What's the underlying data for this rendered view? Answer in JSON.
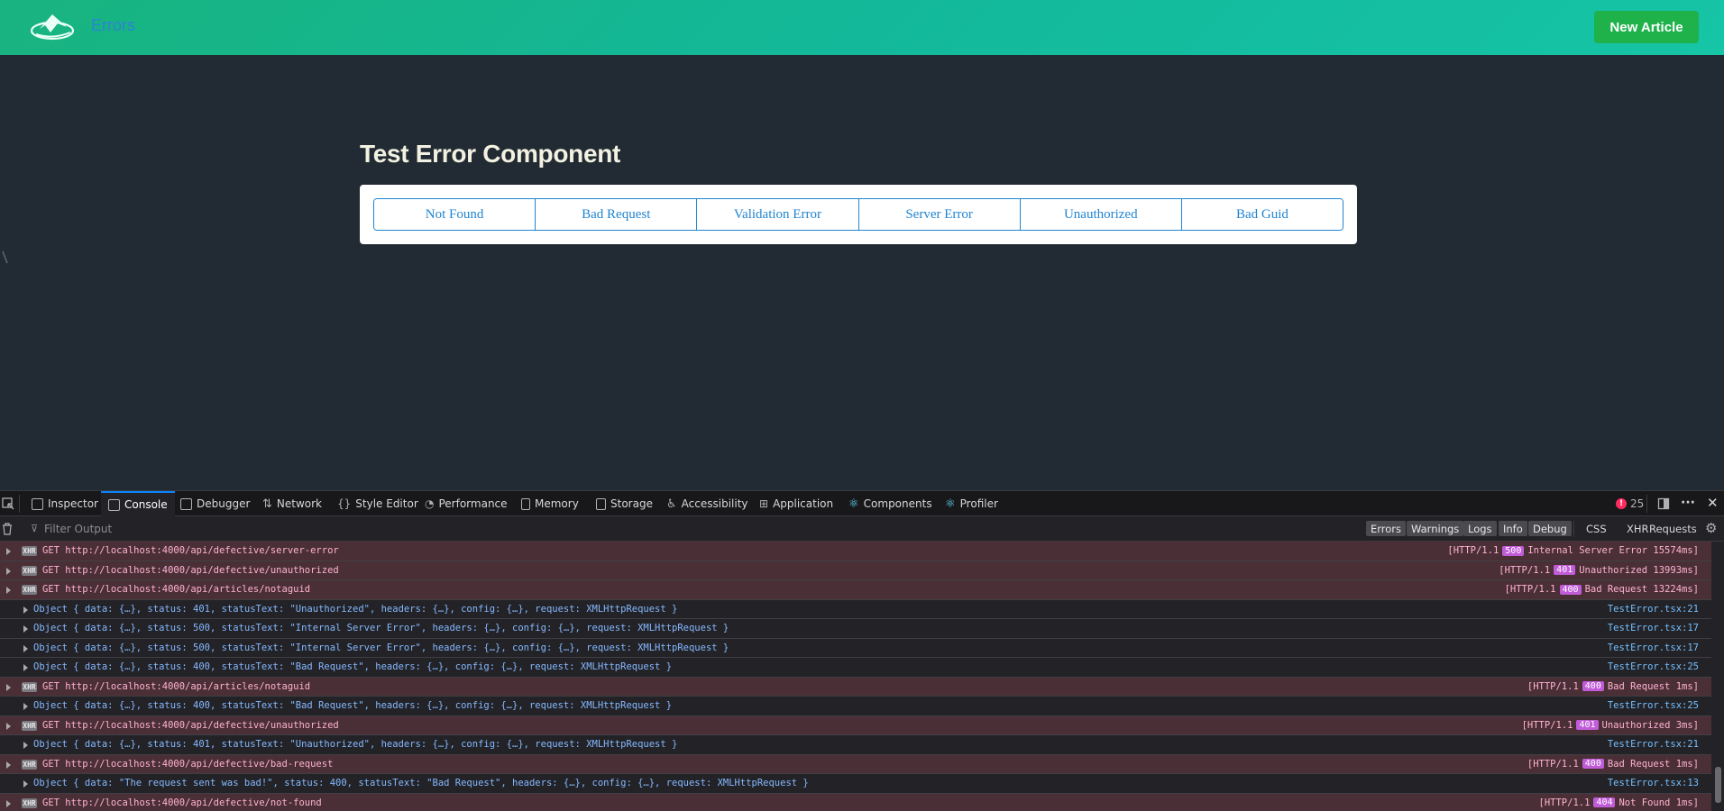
{
  "topnav": {
    "title": "Errors",
    "new_article_label": "New Article",
    "logo_icon": "reactivities-logo",
    "gradient_color": "#16b98f"
  },
  "main": {
    "heading": "Test Error Component",
    "buttons": [
      "Not Found",
      "Bad Request",
      "Validation Error",
      "Server Error",
      "Unauthorized",
      "Bad Guid"
    ],
    "accent": "#2185d0"
  },
  "devtools": {
    "tabs": [
      {
        "label": "Inspector",
        "icon": "inspector-icon"
      },
      {
        "label": "Console",
        "icon": "console-icon"
      },
      {
        "label": "Debugger",
        "icon": "debugger-icon"
      },
      {
        "label": "Network",
        "icon": "network-icon"
      },
      {
        "label": "Style Editor",
        "icon": "style-editor-icon"
      },
      {
        "label": "Performance",
        "icon": "performance-icon"
      },
      {
        "label": "Memory",
        "icon": "memory-icon"
      },
      {
        "label": "Storage",
        "icon": "storage-icon"
      },
      {
        "label": "Accessibility",
        "icon": "accessibility-icon"
      },
      {
        "label": "Application",
        "icon": "application-icon"
      },
      {
        "label": "Components",
        "icon": "react-icon"
      },
      {
        "label": "Profiler",
        "icon": "react-icon"
      }
    ],
    "active_tab": "Console",
    "error_count": "25",
    "filter_placeholder": "Filter Output",
    "filter_levels": [
      "Errors",
      "Warnings",
      "Logs",
      "Info",
      "Debug"
    ],
    "filter_types": [
      "CSS",
      "XHR",
      "Requests"
    ],
    "rows": [
      {
        "type": "xhr",
        "text": "GET http://localhost:4000/api/defective/server-error",
        "http": "[HTTP/1.1",
        "code": "500",
        "tail": "Internal Server Error 15574ms]"
      },
      {
        "type": "xhr",
        "text": "GET http://localhost:4000/api/defective/unauthorized",
        "http": "[HTTP/1.1",
        "code": "401",
        "tail": "Unauthorized 13993ms]"
      },
      {
        "type": "xhr",
        "text": "GET http://localhost:4000/api/articles/notaguid",
        "http": "[HTTP/1.1",
        "code": "400",
        "tail": "Bad Request 13224ms]"
      },
      {
        "type": "log",
        "text": "Object { data: {…}, status: 401, statusText: \"Unauthorized\", headers: {…}, config: {…}, request: XMLHttpRequest }",
        "source": "TestError.tsx:21"
      },
      {
        "type": "log",
        "text": "Object { data: {…}, status: 500, statusText: \"Internal Server Error\", headers: {…}, config: {…}, request: XMLHttpRequest }",
        "source": "TestError.tsx:17"
      },
      {
        "type": "log",
        "text": "Object { data: {…}, status: 500, statusText: \"Internal Server Error\", headers: {…}, config: {…}, request: XMLHttpRequest }",
        "source": "TestError.tsx:17"
      },
      {
        "type": "log",
        "text": "Object { data: {…}, status: 400, statusText: \"Bad Request\", headers: {…}, config: {…}, request: XMLHttpRequest }",
        "source": "TestError.tsx:25"
      },
      {
        "type": "xhr",
        "text": "GET http://localhost:4000/api/articles/notaguid",
        "http": "[HTTP/1.1",
        "code": "400",
        "tail": "Bad Request 1ms]"
      },
      {
        "type": "log",
        "text": "Object { data: {…}, status: 400, statusText: \"Bad Request\", headers: {…}, config: {…}, request: XMLHttpRequest }",
        "source": "TestError.tsx:25"
      },
      {
        "type": "xhr",
        "text": "GET http://localhost:4000/api/defective/unauthorized",
        "http": "[HTTP/1.1",
        "code": "401",
        "tail": "Unauthorized 3ms]"
      },
      {
        "type": "log",
        "text": "Object { data: {…}, status: 401, statusText: \"Unauthorized\", headers: {…}, config: {…}, request: XMLHttpRequest }",
        "source": "TestError.tsx:21"
      },
      {
        "type": "xhr",
        "text": "GET http://localhost:4000/api/defective/bad-request",
        "http": "[HTTP/1.1",
        "code": "400",
        "tail": "Bad Request 1ms]"
      },
      {
        "type": "log",
        "text": "Object { data: \"The request sent was bad!\", status: 400, statusText: \"Bad Request\", headers: {…}, config: {…}, request: XMLHttpRequest }",
        "source": "TestError.tsx:13"
      },
      {
        "type": "xhr",
        "text": "GET http://localhost:4000/api/defective/not-found",
        "http": "[HTTP/1.1",
        "code": "404",
        "tail": "Not Found 1ms]"
      }
    ]
  }
}
